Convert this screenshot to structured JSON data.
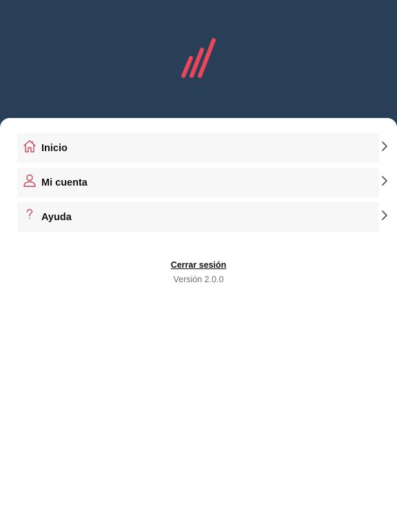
{
  "header": {
    "background_color": "#283f57",
    "logo_icon": "triple-slash-logo",
    "logo_color": "#e8475a"
  },
  "menu": {
    "accent_color": "#c9455a",
    "items": [
      {
        "label": "Inicio",
        "icon": "home-icon"
      },
      {
        "label": "Mi cuenta",
        "icon": "user-icon"
      },
      {
        "label": "Ayuda",
        "icon": "help-icon"
      }
    ]
  },
  "footer": {
    "logout_label": "Cerrar sesión",
    "version_label": "Versión 2.0.0"
  }
}
